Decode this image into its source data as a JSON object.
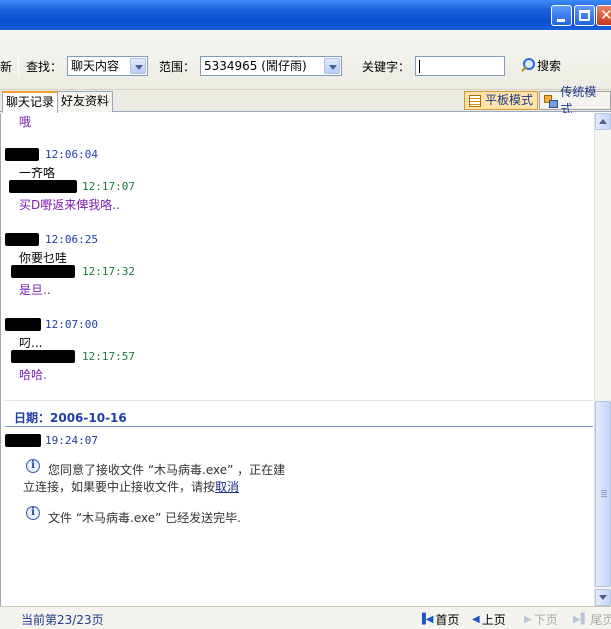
{
  "window": {
    "minimize": "minimize",
    "maximize": "maximize",
    "close": "close"
  },
  "toolbar": {
    "partial_left_label": "新",
    "find_label": "查找：",
    "find_value": "聊天内容",
    "range_label": "范围：",
    "range_value": "5334965 (鬧仔雨)",
    "keyword_label": "关键字：",
    "keyword_value": "",
    "search_button": "搜索"
  },
  "tabs": [
    {
      "label": "聊天记录",
      "active": true
    },
    {
      "label": "好友资料",
      "active": false
    }
  ],
  "view_modes": [
    {
      "label": "平板模式",
      "active": true
    },
    {
      "label": "传统模式",
      "active": false
    }
  ],
  "messages": [
    {
      "text": "哦"
    },
    {
      "time": "12:06:04",
      "text": "一齐咯"
    },
    {
      "time": "12:17:07",
      "text": "买D嘢返来俾我咯.."
    },
    {
      "time": "12:06:25",
      "text": "你要乜哇"
    },
    {
      "time": "12:17:32",
      "text": "是旦.."
    },
    {
      "time": "12:07:00",
      "text": "叼..."
    },
    {
      "time": "12:17:57",
      "text": "哈哈."
    }
  ],
  "date_header": "日期：2006-10-16",
  "last_sender_time": "19:24:07",
  "system_messages": {
    "file_accept_line1": "您同意了接收文件 “木马病毒.exe” ，正在建",
    "file_accept_line2": "立连接，如果要中止接收文件，请按",
    "cancel_link": "取消",
    "file_sent": "文件 “木马病毒.exe” 已经发送完毕."
  },
  "footer": {
    "page_info": "当前第23/23页",
    "first": "首页",
    "prev": "上页",
    "next": "下页",
    "last": "尾页"
  },
  "colors": {
    "title_bar": "#0b4fd0",
    "sender_time": "#1f3fa8",
    "self_time": "#1a7a3a",
    "self_text": "#7a1fb0",
    "date_header": "#1f3fa8"
  }
}
